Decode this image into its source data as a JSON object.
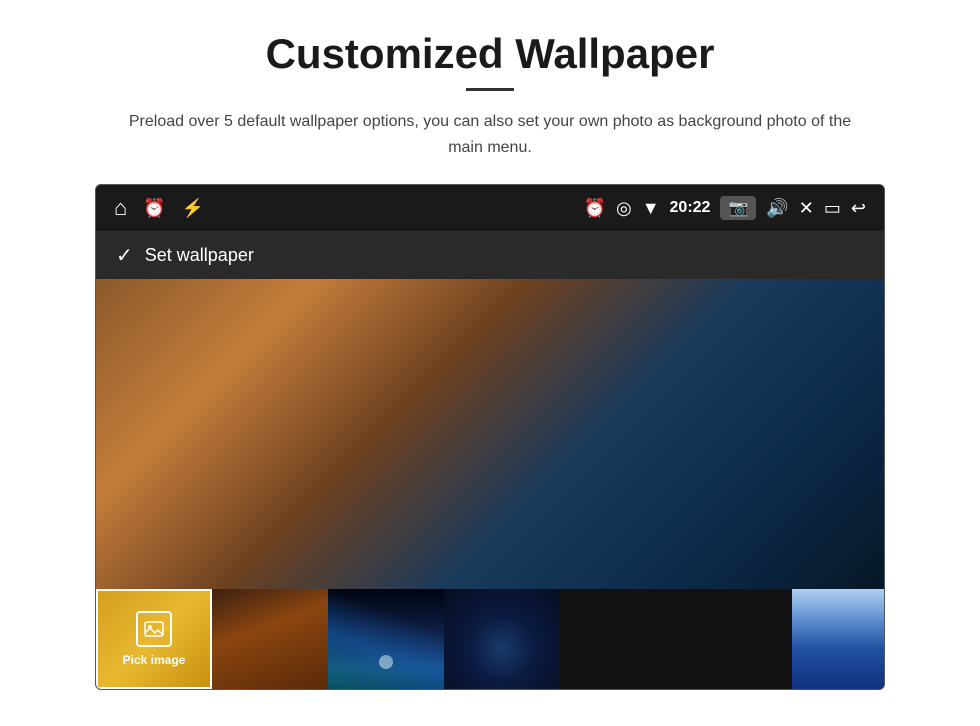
{
  "page": {
    "title": "Customized Wallpaper",
    "subtitle": "Preload over 5 default wallpaper options, you can also set your own photo as background photo of the main menu.",
    "divider": "—"
  },
  "device": {
    "time": "20:22",
    "status_bar": {
      "left_icons": [
        "home",
        "alarm",
        "usb"
      ],
      "right_icons": [
        "alarm",
        "location",
        "wifi",
        "time",
        "camera",
        "volume",
        "close",
        "window",
        "back"
      ]
    },
    "wallpaper_bar": {
      "label": "Set wallpaper"
    },
    "thumbnail_strip": {
      "pick_label": "Pick image",
      "thumbnails": [
        {
          "id": 1,
          "type": "pick"
        },
        {
          "id": 2,
          "type": "brown"
        },
        {
          "id": 3,
          "type": "space"
        },
        {
          "id": 4,
          "type": "galaxy"
        },
        {
          "id": 5,
          "type": "wave"
        },
        {
          "id": 6,
          "type": "blue"
        },
        {
          "id": 7,
          "type": "light"
        }
      ]
    }
  }
}
